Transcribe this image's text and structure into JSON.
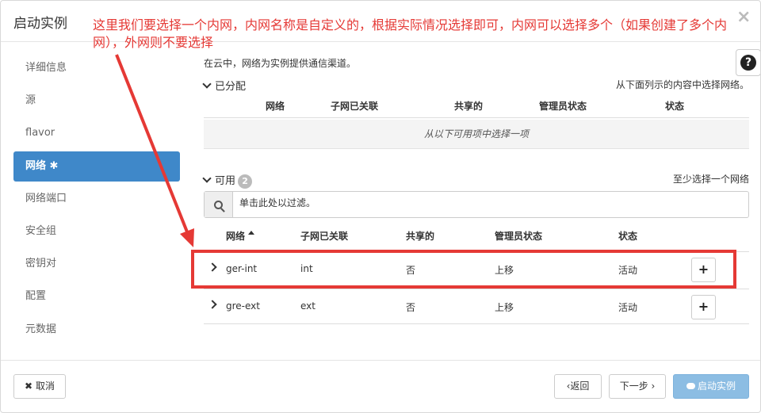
{
  "modal": {
    "title": "启动实例",
    "close": "×",
    "help": "?"
  },
  "annotation": "这里我们要选择一个内网，内网名称是自定义的，根据实际情况选择即可，内网可以选择多个（如果创建了多个内网），外网则不要选择",
  "sidebar": {
    "items": [
      {
        "label": "详细信息"
      },
      {
        "label": "源"
      },
      {
        "label": "flavor"
      },
      {
        "label": "网络 ✱"
      },
      {
        "label": "网络端口"
      },
      {
        "label": "安全组"
      },
      {
        "label": "密钥对"
      },
      {
        "label": "配置"
      },
      {
        "label": "元数据"
      }
    ]
  },
  "content": {
    "description": "在云中，网络为实例提供通信渠道。",
    "allocated": {
      "title": "已分配",
      "hint": "从下面列示的内容中选择网络。",
      "columns": [
        "网络",
        "子网已关联",
        "共享的",
        "管理员状态",
        "状态"
      ],
      "empty": "从以下可用项中选择一项"
    },
    "available": {
      "title": "可用",
      "count": "2",
      "hint": "至少选择一个网络",
      "filter_placeholder": "单击此处以过滤。",
      "columns": [
        "网络",
        "子网已关联",
        "共享的",
        "管理员状态",
        "状态"
      ],
      "rows": [
        {
          "network": "ger-int",
          "subnet": "int",
          "shared": "否",
          "admin_state": "上移",
          "status": "活动",
          "action": "+"
        },
        {
          "network": "gre-ext",
          "subnet": "ext",
          "shared": "否",
          "admin_state": "上移",
          "status": "活动",
          "action": "+"
        }
      ]
    }
  },
  "footer": {
    "cancel": "取消",
    "back": "‹返回",
    "next": "下一步 ›",
    "launch": "启动实例"
  },
  "colors": {
    "accent": "#3f88c9",
    "annotation": "#e53935",
    "primary_disabled": "#8cbde3"
  }
}
